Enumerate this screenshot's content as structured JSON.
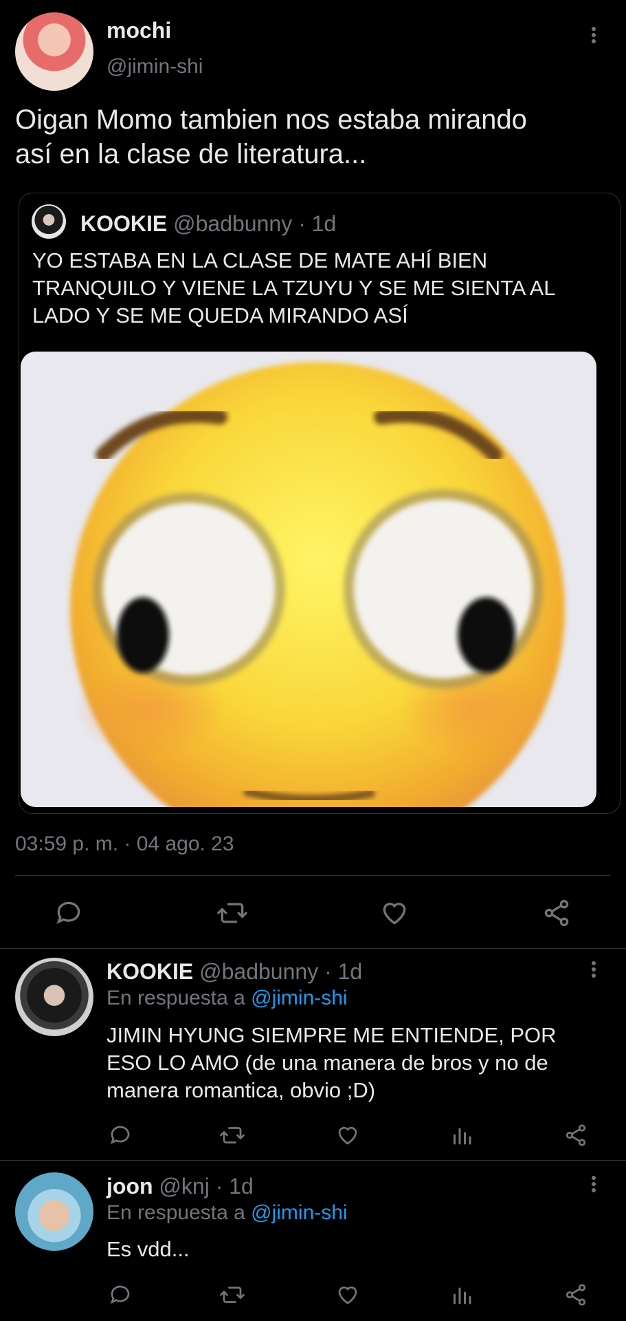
{
  "main_tweet": {
    "display_name": "mochi",
    "handle": "@jimin-shi",
    "text_line1": "Oigan Momo tambien nos estaba mirando",
    "text_line2": "así en la clase de literatura...",
    "timestamp": "03:59 p. m. · 04 ago. 23",
    "quoted": {
      "display_name": "KOOKIE",
      "handle": "@badbunny",
      "time": "· 1d",
      "line1": "YO ESTABA EN LA CLASE DE MATE AHÍ BIEN",
      "line2": "TRANQUILO Y VIENE LA TZUYU Y SE ME SIENTA AL",
      "line3": "LADO Y SE ME QUEDA MIRANDO ASÍ"
    }
  },
  "replies": [
    {
      "display_name": "KOOKIE",
      "handle": "@badbunny",
      "time": "· 1d",
      "reply_prefix": "En respuesta a",
      "reply_to": "@jimin-shi",
      "line1": "JIMIN HYUNG SIEMPRE ME ENTIENDE, POR",
      "line2": "ESO LO AMO (de una manera de bros y no de",
      "line3": "manera romantica, obvio ;D)"
    },
    {
      "display_name": "joon",
      "handle": "@knj",
      "time": "· 1d",
      "reply_prefix": "En respuesta a",
      "reply_to": "@jimin-shi",
      "line1": "Es vdd..."
    }
  ],
  "icons": [
    "reply-icon",
    "retweet-icon",
    "like-icon",
    "share-icon",
    "analytics-icon",
    "more-icon"
  ]
}
